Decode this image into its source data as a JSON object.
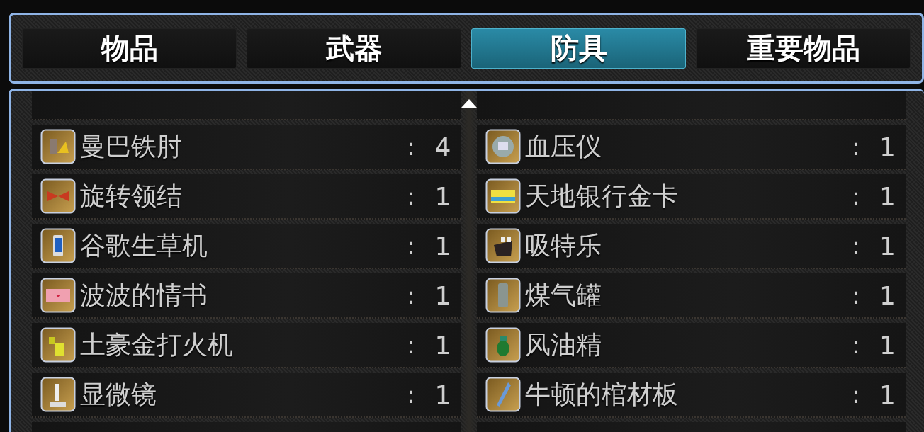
{
  "tabs": [
    {
      "label": "物品",
      "selected": false
    },
    {
      "label": "武器",
      "selected": false
    },
    {
      "label": "防具",
      "selected": true
    },
    {
      "label": "重要物品",
      "selected": false
    }
  ],
  "columns": [
    {
      "items": [
        {
          "name": "曼巴铁肘",
          "count": "4"
        },
        {
          "name": "旋转领结",
          "count": "1"
        },
        {
          "name": "谷歌生草机",
          "count": "1"
        },
        {
          "name": "波波的情书",
          "count": "1"
        },
        {
          "name": "土豪金打火机",
          "count": "1"
        },
        {
          "name": "显微镜",
          "count": "1"
        }
      ]
    },
    {
      "items": [
        {
          "name": "血压仪",
          "count": "1"
        },
        {
          "name": "天地银行金卡",
          "count": "1"
        },
        {
          "name": "吸特乐",
          "count": "1"
        },
        {
          "name": "煤气罐",
          "count": "1"
        },
        {
          "name": "风油精",
          "count": "1"
        },
        {
          "name": "牛顿的棺材板",
          "count": "1"
        }
      ]
    }
  ],
  "separator": ":"
}
